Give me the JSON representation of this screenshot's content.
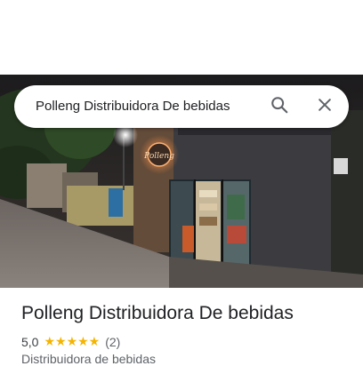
{
  "search": {
    "query": "Polleng Distribuidora De bebidas"
  },
  "place": {
    "name": "Polleng Distribuidora De bebidas",
    "rating": "5,0",
    "stars": "★★★★★",
    "review_count": "(2)",
    "category": "Distribuidora de bebidas",
    "sign_text": "Polleng"
  },
  "icons": {
    "search": "search-icon",
    "close": "close-icon"
  },
  "colors": {
    "star": "#f4b400",
    "sign_glow": "#ff8a3d"
  }
}
